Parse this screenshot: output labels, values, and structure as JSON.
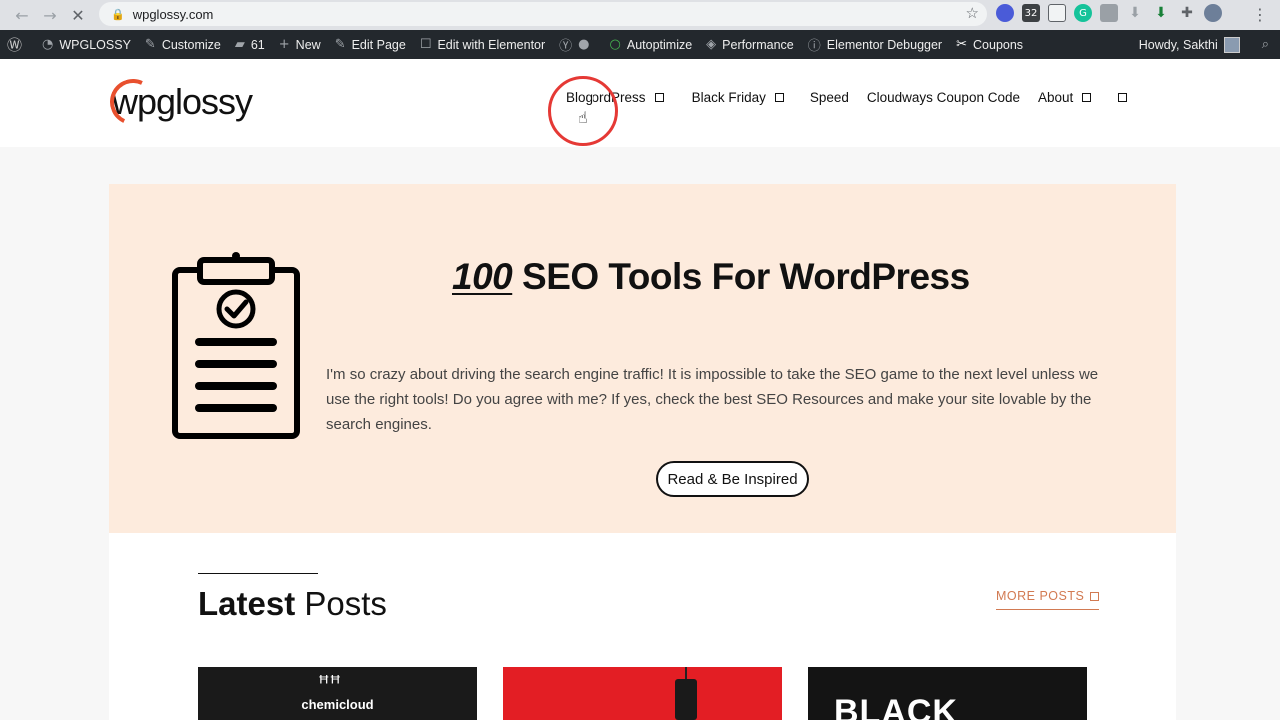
{
  "browser": {
    "url": "wpglossy.com",
    "back_icon": "arrow-left-icon",
    "forward_icon": "arrow-right-icon",
    "reload_icon": "close-loading-icon"
  },
  "adminbar": {
    "items": [
      {
        "label": "WPGLOSSY",
        "icon": "dashboard-icon"
      },
      {
        "label": "Customize",
        "icon": "brush-icon"
      },
      {
        "label": "61",
        "icon": "comment-icon"
      },
      {
        "label": "New",
        "icon": "plus-icon"
      },
      {
        "label": "Edit Page",
        "icon": "pencil-icon"
      },
      {
        "label": "Edit with Elementor",
        "icon": "elementor-icon"
      },
      {
        "label": "Autoptimize",
        "icon": "status-dot-icon"
      },
      {
        "label": "Performance",
        "icon": "performance-icon"
      },
      {
        "label": "Elementor Debugger",
        "icon": "info-icon"
      },
      {
        "label": "Coupons",
        "icon": "scissors-icon"
      }
    ],
    "howdy": "Howdy, Sakthi"
  },
  "header": {
    "logo": "wpglossy",
    "nav": [
      {
        "label": "Blog",
        "has_sub": false
      },
      {
        "label": "WordPress",
        "has_sub": true
      },
      {
        "label": "Black Friday",
        "has_sub": true
      },
      {
        "label": "Speed",
        "has_sub": false
      },
      {
        "label": "Cloudways Coupon Code",
        "has_sub": false
      },
      {
        "label": "About",
        "has_sub": true
      }
    ]
  },
  "hero": {
    "title_number": "100",
    "title_rest": " SEO Tools For WordPress",
    "text": "I'm so crazy about driving the search engine traffic! It is impossible to take the SEO game to the next level unless we use the right tools! Do you agree with me? If yes, check the best SEO Resources and make your site lovable by the search engines.",
    "button": "Read & Be Inspired"
  },
  "posts": {
    "title_bold": "Latest",
    "title_rest": " Posts",
    "more": "MORE POSTS",
    "cards": [
      {
        "label": "chemicloud"
      },
      {
        "label": ""
      },
      {
        "label": "BLACK"
      }
    ]
  },
  "colors": {
    "admin_bar": "#23282d",
    "hero_bg": "#fdebdd",
    "accent": "#d27a52",
    "highlight_circle": "#e53935"
  }
}
